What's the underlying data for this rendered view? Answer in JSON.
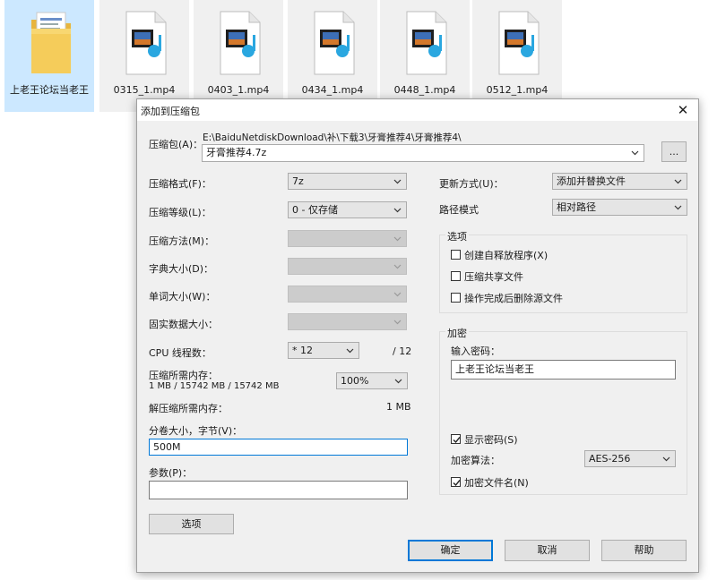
{
  "desktop": {
    "folder": {
      "name": "上老王论坛当老王"
    },
    "files": [
      {
        "name": "0315_1.mp4"
      },
      {
        "name": "0403_1.mp4"
      },
      {
        "name": "0434_1.mp4"
      },
      {
        "name": "0448_1.mp4"
      },
      {
        "name": "0512_1.mp4"
      }
    ]
  },
  "dialog": {
    "title": "添加到压缩包",
    "close_label": "✕",
    "archive": {
      "label": "压缩包(A)：",
      "path": "E:\\BaiduNetdiskDownload\\补\\下载3\\牙膏推荐4\\牙膏推荐4\\",
      "name": "牙膏推荐4.7z",
      "browse_label": "..."
    },
    "left": {
      "format_label": "压缩格式(F)：",
      "format_value": "7z",
      "level_label": "压缩等级(L)：",
      "level_value": "0 - 仅存储",
      "method_label": "压缩方法(M)：",
      "dict_label": "字典大小(D)：",
      "word_label": "单词大小(W)：",
      "solid_label": "固实数据大小：",
      "cpu_label": "CPU 线程数：",
      "cpu_value": "* 12",
      "cpu_max": "/ 12",
      "mem_label": "压缩所需内存：",
      "mem_value": "1 MB / 15742 MB / 15742 MB",
      "mem_percent": "100%",
      "decomp_label": "解压缩所需内存：",
      "decomp_value": "1 MB",
      "volume_label": "分卷大小，字节(V)：",
      "volume_value": "500M",
      "params_label": "参数(P)：",
      "params_value": "",
      "options_button": "选项"
    },
    "right": {
      "update_label": "更新方式(U)：",
      "update_value": "添加并替换文件",
      "path_label": "路径模式",
      "path_value": "相对路径",
      "options_group": "选项",
      "opt_sfx": "创建自释放程序(X)",
      "opt_shared": "压缩共享文件",
      "opt_delete": "操作完成后删除源文件",
      "encrypt_group": "加密",
      "password_label": "输入密码：",
      "password_value": "上老王论坛当老王",
      "show_password": "显示密码(S)",
      "algo_label": "加密算法：",
      "algo_value": "AES-256",
      "encrypt_names": "加密文件名(N)"
    },
    "buttons": {
      "ok": "确定",
      "cancel": "取消",
      "help": "帮助"
    }
  }
}
